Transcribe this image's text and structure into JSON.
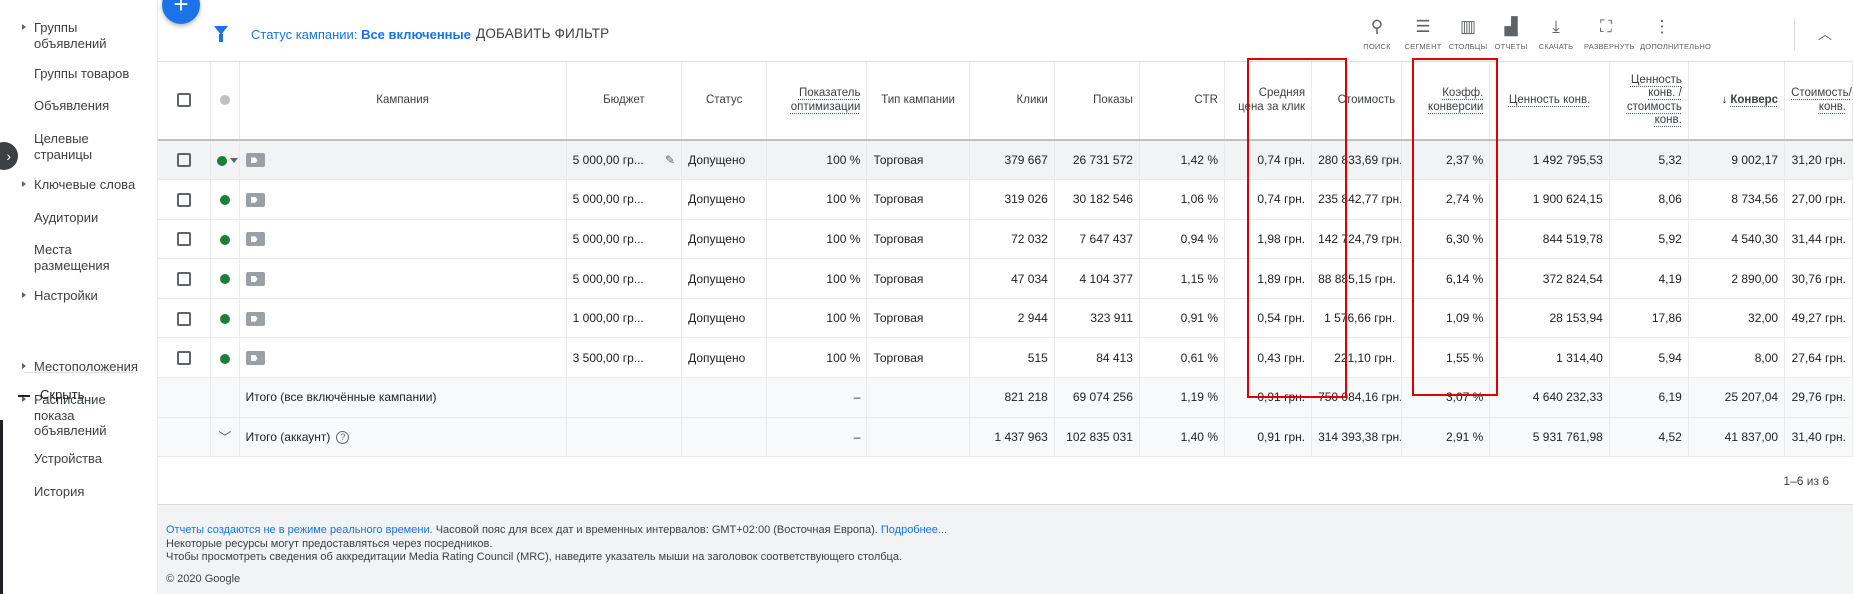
{
  "sidebar": {
    "items": [
      {
        "label_lines": [
          "Группы",
          "объявлений"
        ],
        "caret": true
      },
      {
        "label_lines": [
          "Группы товаров"
        ],
        "caret": false
      },
      {
        "label_lines": [
          "Объявления"
        ],
        "caret": false
      },
      {
        "label_lines": [
          "Целевые",
          "страницы"
        ],
        "caret": false
      },
      {
        "label_lines": [
          "Ключевые слова"
        ],
        "caret": true
      },
      {
        "label_lines": [
          "Аудитории"
        ],
        "caret": false
      },
      {
        "label_lines": [
          "Места",
          "размещения"
        ],
        "caret": false
      },
      {
        "label_lines": [
          "Настройки"
        ],
        "caret": true
      },
      {
        "label_lines": [
          "Местоположения"
        ],
        "caret": true
      },
      {
        "label_lines": [
          "Расписание",
          "показа",
          "объявлений"
        ],
        "caret": true
      },
      {
        "label_lines": [
          "Устройства"
        ],
        "caret": false
      },
      {
        "label_lines": [
          "История"
        ],
        "caret": false
      }
    ],
    "hide_label": "Скрыть"
  },
  "fab_label": "+",
  "toolbar": {
    "filter_prefix": "Статус кампании:",
    "filter_value": "Все включенные",
    "add_filter": "ДОБАВИТЬ ФИЛЬТР",
    "tools": [
      {
        "icon": "search-icon",
        "glyph": "⚲",
        "label": "поиск"
      },
      {
        "icon": "segment-icon",
        "glyph": "☰",
        "label": "сегмент"
      },
      {
        "icon": "columns-icon",
        "glyph": "▥",
        "label": "столбцы"
      },
      {
        "icon": "reports-icon",
        "glyph": "▟",
        "label": "отчеты"
      },
      {
        "icon": "download-icon",
        "glyph": "⤓",
        "label": "скачать"
      },
      {
        "icon": "expand-icon",
        "glyph": "⛶",
        "label": "развернуть"
      },
      {
        "icon": "more-icon",
        "glyph": "⋮",
        "label": "дополнительно"
      }
    ]
  },
  "table": {
    "headers": {
      "campaign": "Кампания",
      "budget": "Бюджет",
      "status": "Статус",
      "optimization": "Показатель оптимизации",
      "campaign_type": "Тип кампании",
      "clicks": "Клики",
      "impressions": "Показы",
      "ctr": "CTR",
      "avg_cpc": "Средняя цена за клик",
      "cost": "Стоимость",
      "conv_rate": "Коэфф. конверсии",
      "conv_value": "Ценность конв.",
      "value_per_cost": "Ценность конв. / стоимость конв.",
      "conversions": "Конверс",
      "cost_per_conv": "Стоимость/ конв."
    },
    "rows": [
      {
        "budget": "5 000,00 гр...",
        "status": "Допущено",
        "optimization": "100 %",
        "type": "Торговая",
        "clicks": "379 667",
        "impressions": "26 731 572",
        "ctr": "1,42 %",
        "cpc": "0,74 грн.",
        "cost": "280 833,69 грн.",
        "conv_rate": "2,37 %",
        "conv_value": "1 492 795,53",
        "value_cost": "5,32",
        "conversions": "9 002,17",
        "cost_conv": "31,20 грн."
      },
      {
        "budget": "5 000,00 гр...",
        "status": "Допущено",
        "optimization": "100 %",
        "type": "Торговая",
        "clicks": "319 026",
        "impressions": "30 182 546",
        "ctr": "1,06 %",
        "cpc": "0,74 грн.",
        "cost": "235 842,77 грн.",
        "conv_rate": "2,74 %",
        "conv_value": "1 900 624,15",
        "value_cost": "8,06",
        "conversions": "8 734,56",
        "cost_conv": "27,00 грн."
      },
      {
        "budget": "5 000,00 гр...",
        "status": "Допущено",
        "optimization": "100 %",
        "type": "Торговая",
        "clicks": "72 032",
        "impressions": "7 647 437",
        "ctr": "0,94 %",
        "cpc": "1,98 грн.",
        "cost": "142 724,79 грн.",
        "conv_rate": "6,30 %",
        "conv_value": "844 519,78",
        "value_cost": "5,92",
        "conversions": "4 540,30",
        "cost_conv": "31,44 грн."
      },
      {
        "budget": "5 000,00 гр...",
        "status": "Допущено",
        "optimization": "100 %",
        "type": "Торговая",
        "clicks": "47 034",
        "impressions": "4 104 377",
        "ctr": "1,15 %",
        "cpc": "1,89 грн.",
        "cost": "88 885,15 грн.",
        "conv_rate": "6,14 %",
        "conv_value": "372 824,54",
        "value_cost": "4,19",
        "conversions": "2 890,00",
        "cost_conv": "30,76 грн."
      },
      {
        "budget": "1 000,00 гр...",
        "status": "Допущено",
        "optimization": "100 %",
        "type": "Торговая",
        "clicks": "2 944",
        "impressions": "323 911",
        "ctr": "0,91 %",
        "cpc": "0,54 грн.",
        "cost": "1 576,66 грн.",
        "conv_rate": "1,09 %",
        "conv_value": "28 153,94",
        "value_cost": "17,86",
        "conversions": "32,00",
        "cost_conv": "49,27 грн."
      },
      {
        "budget": "3 500,00 гр...",
        "status": "Допущено",
        "optimization": "100 %",
        "type": "Торговая",
        "clicks": "515",
        "impressions": "84 413",
        "ctr": "0,61 %",
        "cpc": "0,43 грн.",
        "cost": "221,10 грн.",
        "conv_rate": "1,55 %",
        "conv_value": "1 314,40",
        "value_cost": "5,94",
        "conversions": "8,00",
        "cost_conv": "27,64 грн."
      }
    ],
    "totals": [
      {
        "label": "Итого (все включённые кампании)",
        "optimization": "–",
        "clicks": "821 218",
        "impressions": "69 074 256",
        "ctr": "1,19 %",
        "cpc": "0,91 грн.",
        "cost": "750 084,16 грн.",
        "conv_rate": "3,07 %",
        "conv_value": "4 640 232,33",
        "value_cost": "6,19",
        "conversions": "25 207,04",
        "cost_conv": "29,76 грн."
      },
      {
        "label": "Итого (аккаунт)",
        "optimization": "–",
        "clicks": "1 437 963",
        "impressions": "102 835 031",
        "ctr": "1,40 %",
        "cpc": "0,91 грн.",
        "cost": "314 393,38 грн.",
        "conv_rate": "2,91 %",
        "conv_value": "5 931 761,98",
        "value_cost": "4,52",
        "conversions": "41 837,00",
        "cost_conv": "31,40 грн."
      }
    ],
    "pagination": "1–6 из 6"
  },
  "footer": {
    "line1_link": "Отчеты создаются не в режиме реального времени.",
    "line1_text": " Часовой пояс для всех дат и временных интервалов: GMT+02:00 (Восточная Европа). ",
    "line1_more": "Подробнее...",
    "line2": "Некоторые ресурсы могут предоставляться через посредников.",
    "line3": "Чтобы просмотреть сведения об аккредитации Media Rating Council (MRC), наведите указатель мыши на заголовок соответствующего столбца.",
    "copyright": "© 2020 Google"
  },
  "colors": {
    "accent": "#1a73e8",
    "status_green": "#188038",
    "highlight_red": "#e00000"
  }
}
